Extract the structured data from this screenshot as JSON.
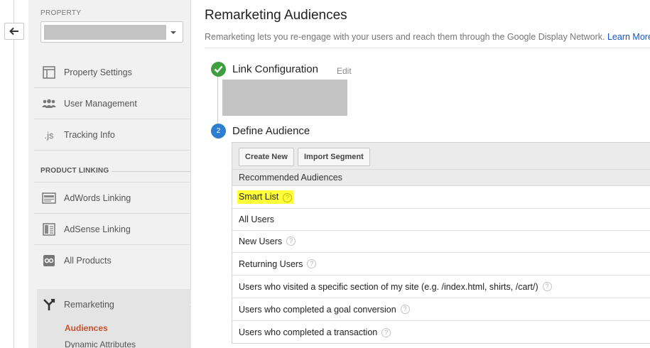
{
  "sidebar": {
    "property_label": "PROPERTY",
    "items": [
      {
        "label": "Property Settings",
        "icon": "property-settings-icon"
      },
      {
        "label": "User Management",
        "icon": "users-icon"
      },
      {
        "label": "Tracking Info",
        "icon": "js-icon"
      }
    ],
    "js_glyph": ".js",
    "product_linking_title": "PRODUCT LINKING",
    "linking_items": [
      {
        "label": "AdWords Linking",
        "icon": "adwords-icon"
      },
      {
        "label": "AdSense Linking",
        "icon": "adsense-icon"
      },
      {
        "label": "All Products",
        "icon": "all-products-icon"
      }
    ],
    "remarketing": {
      "label": "Remarketing",
      "icon": "remarketing-fork-icon",
      "sub_items": [
        "Audiences",
        "Dynamic Attributes"
      ],
      "active": "Audiences"
    }
  },
  "main": {
    "title": "Remarketing Audiences",
    "description": "Remarketing lets you re-engage with your users and reach them through the Google Display Network.",
    "learn_more": "Learn More",
    "step1": {
      "title": "Link Configuration",
      "edit": "Edit",
      "status": "complete"
    },
    "step2": {
      "number": "2",
      "title": "Define Audience"
    },
    "toolbar": {
      "create_new": "Create New",
      "import_segment": "Import Segment"
    },
    "recommended_header": "Recommended Audiences",
    "help_glyph": "?",
    "audiences": [
      {
        "label": "Smart List",
        "help": true,
        "highlighted": true
      },
      {
        "label": "All Users",
        "help": false,
        "highlighted": false
      },
      {
        "label": "New Users",
        "help": true,
        "highlighted": false
      },
      {
        "label": "Returning Users",
        "help": true,
        "highlighted": false
      },
      {
        "label": "Users who visited a specific section of my site (e.g. /index.html, shirts, /cart/)",
        "help": true,
        "highlighted": false
      },
      {
        "label": "Users who completed a goal conversion",
        "help": true,
        "highlighted": false
      },
      {
        "label": "Users who completed a transaction",
        "help": true,
        "highlighted": false
      }
    ]
  },
  "colors": {
    "active_sub_item": "#c5522c",
    "step_complete": "#3f9f3f",
    "step_current": "#2c7fd0",
    "highlight": "#ffff3a",
    "link": "#1155cc"
  }
}
